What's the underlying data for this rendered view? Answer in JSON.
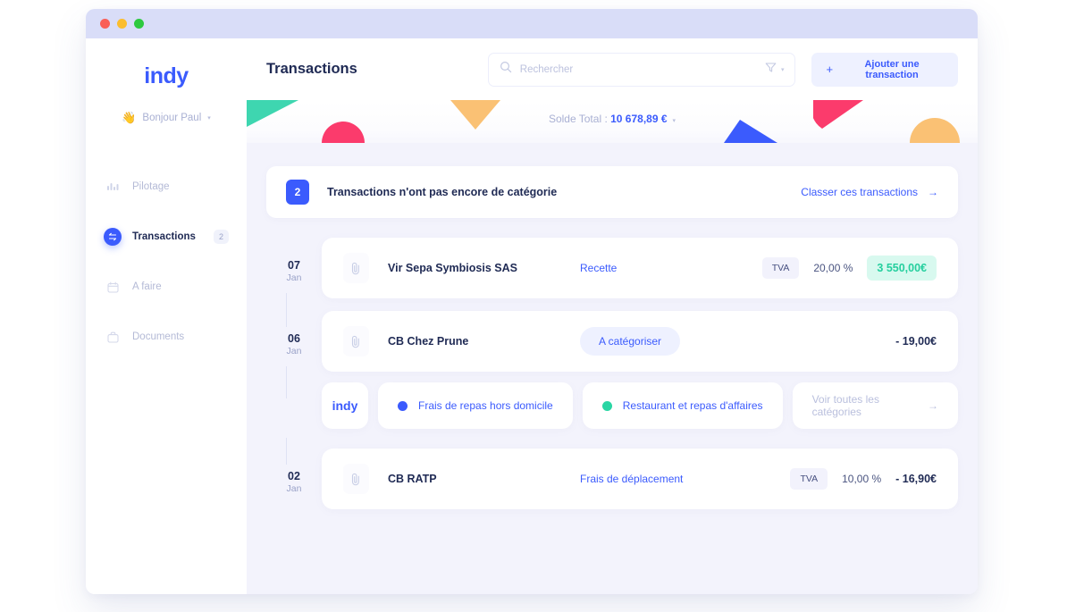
{
  "window": {
    "traffic_lights": [
      "close",
      "minimize",
      "zoom"
    ],
    "colors": {
      "close": "#f95f57",
      "minimize": "#fbbd2e",
      "zoom": "#2dc93f"
    }
  },
  "theme": {
    "brand_blue": "#3b5bfd",
    "ink": "#1f2a54",
    "muted": "#b4bad6",
    "page_bg": "#f3f3fc",
    "credit_green": "#25cf9e",
    "credit_green_bg": "#d8f9ef"
  },
  "sidebar": {
    "logo": "indy",
    "greeting": {
      "emoji": "👋",
      "text": "Bonjour Paul",
      "caret": "▾"
    },
    "items": [
      {
        "label": "Pilotage",
        "icon": "bar-chart-icon",
        "active": false,
        "badge": ""
      },
      {
        "label": "Transactions",
        "icon": "transfer-icon",
        "active": true,
        "badge": "2"
      },
      {
        "label": "A faire",
        "icon": "calendar-icon",
        "active": false,
        "badge": ""
      },
      {
        "label": "Documents",
        "icon": "folder-icon",
        "active": false,
        "badge": ""
      }
    ]
  },
  "topbar": {
    "title": "Transactions",
    "search": {
      "placeholder": "Rechercher",
      "value": "",
      "icon": "search-icon"
    },
    "filter": {
      "icon": "filter-icon",
      "caret": "▾"
    },
    "add_button": {
      "plus": "+",
      "label": "Ajouter une transaction"
    }
  },
  "balance": {
    "label": "Solde Total : ",
    "amount": "10 678,89 €",
    "caret": "▾"
  },
  "confetti": [
    {
      "name": "teal-triangle",
      "color": "#3ed6b0",
      "shape": "triangle-right-cut"
    },
    {
      "name": "pink-half-dome",
      "color": "#fb3b6c",
      "shape": "half-dome"
    },
    {
      "name": "orange-triangle-down",
      "color": "#fac174",
      "shape": "triangle-down"
    },
    {
      "name": "blue-triangle-up",
      "color": "#3b5bfd",
      "shape": "triangle-up"
    },
    {
      "name": "pink-dome-cut",
      "color": "#fb3b6c",
      "shape": "dome-cut"
    },
    {
      "name": "orange-half-dome",
      "color": "#fac174",
      "shape": "half-dome"
    }
  ],
  "alert": {
    "count": "2",
    "text": "Transactions n'ont pas encore de catégorie",
    "link": "Classer ces transactions",
    "arrow": "→"
  },
  "transactions": [
    {
      "day": "07",
      "month": "Jan",
      "attachment_icon": "paperclip-icon",
      "label": "Vir Sepa Symbiosis SAS",
      "category": "Recette",
      "category_style": "plain",
      "tva_chip": "TVA",
      "rate": "20,00 %",
      "amount": "3 550,00€",
      "amount_kind": "credit"
    },
    {
      "day": "06",
      "month": "Jan",
      "attachment_icon": "paperclip-icon",
      "label": "CB Chez Prune",
      "category": "A catégoriser",
      "category_style": "pill",
      "tva_chip": "",
      "rate": "",
      "amount": "- 19,00€",
      "amount_kind": "debit"
    },
    {
      "day": "02",
      "month": "Jan",
      "attachment_icon": "paperclip-icon",
      "label": "CB RATP",
      "category": "Frais de déplacement",
      "category_style": "plain",
      "tva_chip": "TVA",
      "rate": "10,00 %",
      "amount": "- 16,90€",
      "amount_kind": "debit"
    }
  ],
  "suggestions": {
    "logo": "indy",
    "chips": [
      {
        "label": "Frais de repas hors domicile",
        "dot_color": "#3b5bfd"
      },
      {
        "label": "Restaurant et repas d'affaires",
        "dot_color": "#2ad6a4"
      }
    ],
    "see_all": {
      "label": "Voir toutes les catégories",
      "arrow": "→"
    }
  }
}
